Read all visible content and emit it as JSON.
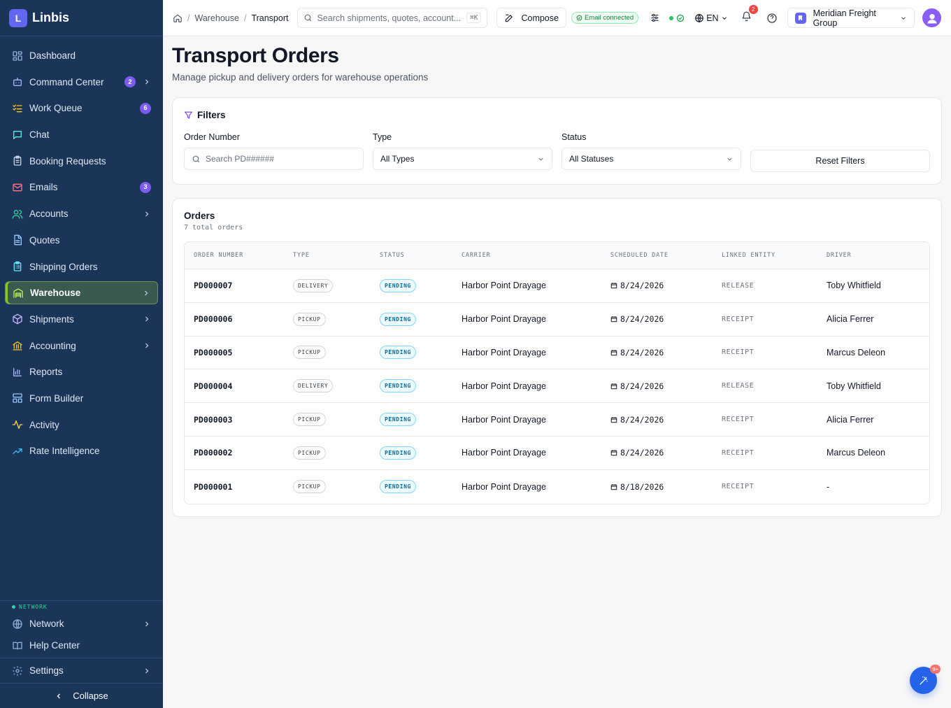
{
  "brand": {
    "logo_letter": "L",
    "name": "Linbis"
  },
  "sidebar": {
    "items": [
      {
        "label": "Dashboard",
        "icon": "dashboard-icon",
        "badge": null,
        "chevron": false,
        "active": false
      },
      {
        "label": "Command Center",
        "icon": "bot-icon",
        "badge": "2",
        "chevron": true,
        "active": false
      },
      {
        "label": "Work Queue",
        "icon": "list-checks-icon",
        "badge": "6",
        "chevron": false,
        "active": false
      },
      {
        "label": "Chat",
        "icon": "chat-icon",
        "badge": null,
        "chevron": false,
        "active": false
      },
      {
        "label": "Booking Requests",
        "icon": "clipboard-icon",
        "badge": null,
        "chevron": false,
        "active": false
      },
      {
        "label": "Emails",
        "icon": "mail-icon",
        "badge": "3",
        "chevron": false,
        "active": false
      },
      {
        "label": "Accounts",
        "icon": "users-icon",
        "badge": null,
        "chevron": true,
        "active": false
      },
      {
        "label": "Quotes",
        "icon": "document-icon",
        "badge": null,
        "chevron": false,
        "active": false
      },
      {
        "label": "Shipping Orders",
        "icon": "clipboard-list-icon",
        "badge": null,
        "chevron": false,
        "active": false
      },
      {
        "label": "Warehouse",
        "icon": "warehouse-icon",
        "badge": null,
        "chevron": true,
        "active": true
      },
      {
        "label": "Shipments",
        "icon": "package-icon",
        "badge": null,
        "chevron": true,
        "active": false
      },
      {
        "label": "Accounting",
        "icon": "bank-icon",
        "badge": null,
        "chevron": true,
        "active": false
      },
      {
        "label": "Reports",
        "icon": "bar-chart-icon",
        "badge": null,
        "chevron": false,
        "active": false
      },
      {
        "label": "Form Builder",
        "icon": "layout-icon",
        "badge": null,
        "chevron": false,
        "active": false
      },
      {
        "label": "Activity",
        "icon": "activity-icon",
        "badge": null,
        "chevron": false,
        "active": false
      },
      {
        "label": "Rate Intelligence",
        "icon": "trending-up-icon",
        "badge": null,
        "chevron": false,
        "active": false
      }
    ],
    "network_label": "NETWORK",
    "network": "Network",
    "help_center": "Help Center",
    "settings": "Settings",
    "collapse": "Collapse"
  },
  "topbar": {
    "breadcrumb": [
      "Warehouse",
      "Transport"
    ],
    "search_placeholder": "Search shipments, quotes, account...",
    "search_shortcut": "⌘K",
    "compose": "Compose",
    "email_status": "Email connected",
    "language": "EN",
    "notification_count": "2",
    "organization": "Meridian Freight Group"
  },
  "page": {
    "title": "Transport Orders",
    "subtitle": "Manage pickup and delivery orders for warehouse operations"
  },
  "filters": {
    "title": "Filters",
    "order_number_label": "Order Number",
    "order_number_placeholder": "Search PD######",
    "type_label": "Type",
    "type_value": "All Types",
    "status_label": "Status",
    "status_value": "All Statuses",
    "reset": "Reset Filters"
  },
  "orders": {
    "title": "Orders",
    "count_text": "7 total orders",
    "columns": [
      "ORDER NUMBER",
      "TYPE",
      "STATUS",
      "CARRIER",
      "SCHEDULED DATE",
      "LINKED ENTITY",
      "DRIVER"
    ],
    "rows": [
      {
        "order": "PD000007",
        "type": "DELIVERY",
        "status": "PENDING",
        "carrier": "Harbor Point Drayage",
        "date": "8/24/2026",
        "linked": "RELEASE",
        "driver": "Toby Whitfield"
      },
      {
        "order": "PD000006",
        "type": "PICKUP",
        "status": "PENDING",
        "carrier": "Harbor Point Drayage",
        "date": "8/24/2026",
        "linked": "RECEIPT",
        "driver": "Alicia Ferrer"
      },
      {
        "order": "PD000005",
        "type": "PICKUP",
        "status": "PENDING",
        "carrier": "Harbor Point Drayage",
        "date": "8/24/2026",
        "linked": "RECEIPT",
        "driver": "Marcus Deleon"
      },
      {
        "order": "PD000004",
        "type": "DELIVERY",
        "status": "PENDING",
        "carrier": "Harbor Point Drayage",
        "date": "8/24/2026",
        "linked": "RELEASE",
        "driver": "Toby Whitfield"
      },
      {
        "order": "PD000003",
        "type": "PICKUP",
        "status": "PENDING",
        "carrier": "Harbor Point Drayage",
        "date": "8/24/2026",
        "linked": "RECEIPT",
        "driver": "Alicia Ferrer"
      },
      {
        "order": "PD000002",
        "type": "PICKUP",
        "status": "PENDING",
        "carrier": "Harbor Point Drayage",
        "date": "8/24/2026",
        "linked": "RECEIPT",
        "driver": "Marcus Deleon"
      },
      {
        "order": "PD000001",
        "type": "PICKUP",
        "status": "PENDING",
        "carrier": "Harbor Point Drayage",
        "date": "8/18/2026",
        "linked": "RECEIPT",
        "driver": "-"
      }
    ]
  },
  "fab": {
    "badge": "9+"
  },
  "colors": {
    "sidebar_bg": "#1b3558",
    "accent": "#6366f1",
    "active_border": "#84cc16",
    "status_blue": "#0369a1",
    "fab": "#2563eb"
  }
}
